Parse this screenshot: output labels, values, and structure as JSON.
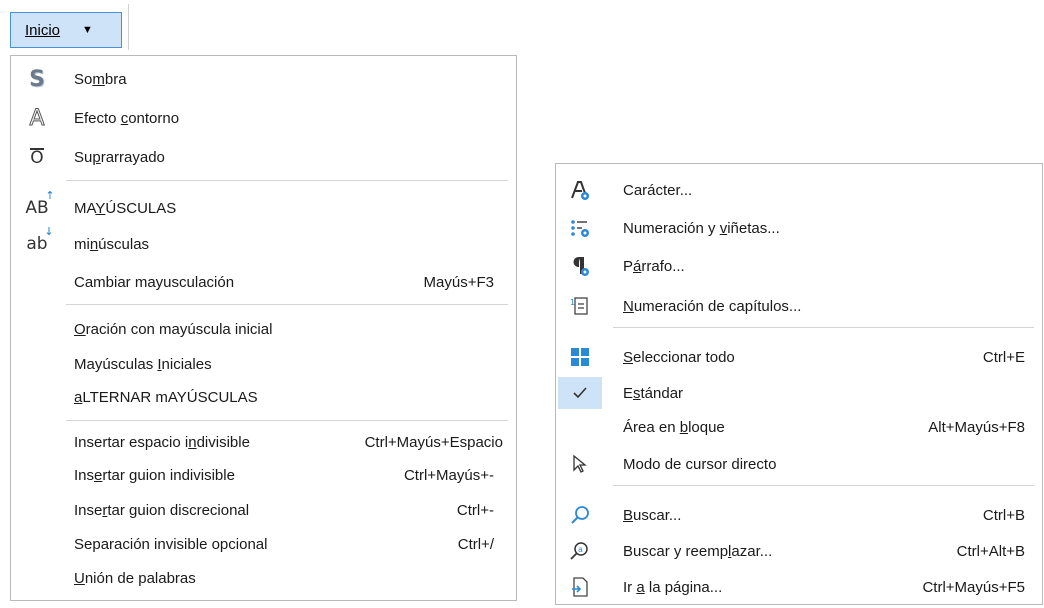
{
  "top_button": {
    "label": "Inicio",
    "caret": "▼"
  },
  "left_menu": {
    "items": [
      {
        "pre": "So",
        "u": "m",
        "post": "bra",
        "shortcut": "",
        "icon": "shadow-icon"
      },
      {
        "pre": "Efecto ",
        "u": "c",
        "post": "ontorno",
        "shortcut": "",
        "icon": "outline-icon"
      },
      {
        "pre": "Su",
        "u": "p",
        "post": "rarrayado",
        "shortcut": "",
        "icon": "overline-icon"
      },
      {
        "pre": "MA",
        "u": "Y",
        "post": "ÚSCULAS",
        "shortcut": "",
        "icon": "uppercase-icon"
      },
      {
        "pre": "mi",
        "u": "n",
        "post": "úsculas",
        "shortcut": "",
        "icon": "lowercase-icon"
      },
      {
        "pre": "Cambiar mayusculación",
        "u": "",
        "post": "",
        "shortcut": "Mayús+F3",
        "icon": ""
      },
      {
        "pre": "",
        "u": "O",
        "post": "ración con mayúscula inicial",
        "shortcut": "",
        "icon": ""
      },
      {
        "pre": "Mayúsculas ",
        "u": "I",
        "post": "niciales",
        "shortcut": "",
        "icon": ""
      },
      {
        "pre": "",
        "u": "a",
        "post": "LTERNAR mAYÚSCULAS",
        "shortcut": "",
        "icon": ""
      },
      {
        "pre": "Insertar espacio i",
        "u": "n",
        "post": "divisible",
        "shortcut": "Ctrl+Mayús+Espacio",
        "icon": ""
      },
      {
        "pre": "Ins",
        "u": "e",
        "post": "rtar guion indivisible",
        "shortcut": "Ctrl+Mayús+-",
        "icon": ""
      },
      {
        "pre": "Inse",
        "u": "r",
        "post": "tar guion discrecional",
        "shortcut": "Ctrl+-",
        "icon": ""
      },
      {
        "pre": "Separación invisible opcional",
        "u": "",
        "post": "",
        "shortcut": "Ctrl+/",
        "icon": ""
      },
      {
        "pre": "",
        "u": "U",
        "post": "nión de palabras",
        "shortcut": "",
        "icon": ""
      }
    ]
  },
  "right_menu": {
    "items": [
      {
        "pre": "Carácter...",
        "u": "",
        "post": "",
        "shortcut": "",
        "icon": "character-icon"
      },
      {
        "pre": "Numeración y ",
        "u": "v",
        "post": "iñetas...",
        "shortcut": "",
        "icon": "bullets-icon"
      },
      {
        "pre": "P",
        "u": "á",
        "post": "rrafo...",
        "shortcut": "",
        "icon": "paragraph-icon"
      },
      {
        "pre": "",
        "u": "N",
        "post": "umeración de capítulos...",
        "shortcut": "",
        "icon": "chapter-numbering-icon"
      },
      {
        "pre": "",
        "u": "S",
        "post": "eleccionar todo",
        "shortcut": "Ctrl+E",
        "icon": "select-all-icon"
      },
      {
        "pre": "E",
        "u": "s",
        "post": "tándar",
        "shortcut": "",
        "icon": "checkmark-icon"
      },
      {
        "pre": "Área en ",
        "u": "b",
        "post": "loque",
        "shortcut": "Alt+Mayús+F8",
        "icon": ""
      },
      {
        "pre": "Modo de cursor directo",
        "u": "",
        "post": "",
        "shortcut": "",
        "icon": "cursor-icon"
      },
      {
        "pre": "",
        "u": "B",
        "post": "uscar...",
        "shortcut": "Ctrl+B",
        "icon": "search-icon"
      },
      {
        "pre": "Buscar y reemp",
        "u": "l",
        "post": "azar...",
        "shortcut": "Ctrl+Alt+B",
        "icon": "find-replace-icon"
      },
      {
        "pre": "Ir ",
        "u": "a",
        "post": " la página...",
        "shortcut": "Ctrl+Mayús+F5",
        "icon": "goto-page-icon"
      }
    ]
  },
  "colors": {
    "accent": "#1e7fc4",
    "highlight": "#cfe3f8"
  }
}
